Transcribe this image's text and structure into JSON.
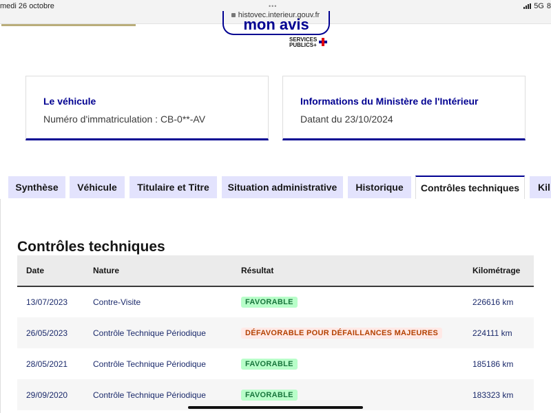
{
  "status_bar": {
    "date": "medi 26 octobre",
    "url": "histovec.interieur.gouv.fr",
    "network": "5G",
    "battery": "8"
  },
  "header": {
    "logo_text": "mon avis",
    "services_line1": "SERVICES",
    "services_line2": "PUBLICS+"
  },
  "cards": {
    "vehicle": {
      "title": "Le véhicule",
      "text": "Numéro d'immatriculation : CB-0**-AV"
    },
    "ministry": {
      "title": "Informations du Ministère de l'Intérieur",
      "text": "Datant du 23/10/2024"
    }
  },
  "tabs": [
    {
      "label": "Synthèse"
    },
    {
      "label": "Véhicule"
    },
    {
      "label": "Titulaire et Titre"
    },
    {
      "label": "Situation administrative"
    },
    {
      "label": "Historique"
    },
    {
      "label": "Contrôles techniques"
    },
    {
      "label": "Kil"
    }
  ],
  "section_title": "Contrôles techniques",
  "table": {
    "headers": {
      "date": "Date",
      "nature": "Nature",
      "result": "Résultat",
      "km": "Kilométrage"
    },
    "rows": [
      {
        "date": "13/07/2023",
        "nature": "Contre-Visite",
        "result": "FAVORABLE",
        "km": "226616 km"
      },
      {
        "date": "26/05/2023",
        "nature": "Contrôle Technique Périodique",
        "result": "DÉFAVORABLE POUR DÉFAILLANCES MAJEURES",
        "km": "224111 km"
      },
      {
        "date": "28/05/2021",
        "nature": "Contrôle Technique Périodique",
        "result": "FAVORABLE",
        "km": "185186 km"
      },
      {
        "date": "29/09/2020",
        "nature": "Contrôle Technique Périodique",
        "result": "FAVORABLE",
        "km": "183323 km"
      }
    ]
  },
  "colors": {
    "primary": "#000091",
    "tab_bg": "#e3e3fd",
    "success_bg": "#b8fec9",
    "success_text": "#18753c",
    "error_bg": "#ffe9e6",
    "error_text": "#b34000"
  }
}
